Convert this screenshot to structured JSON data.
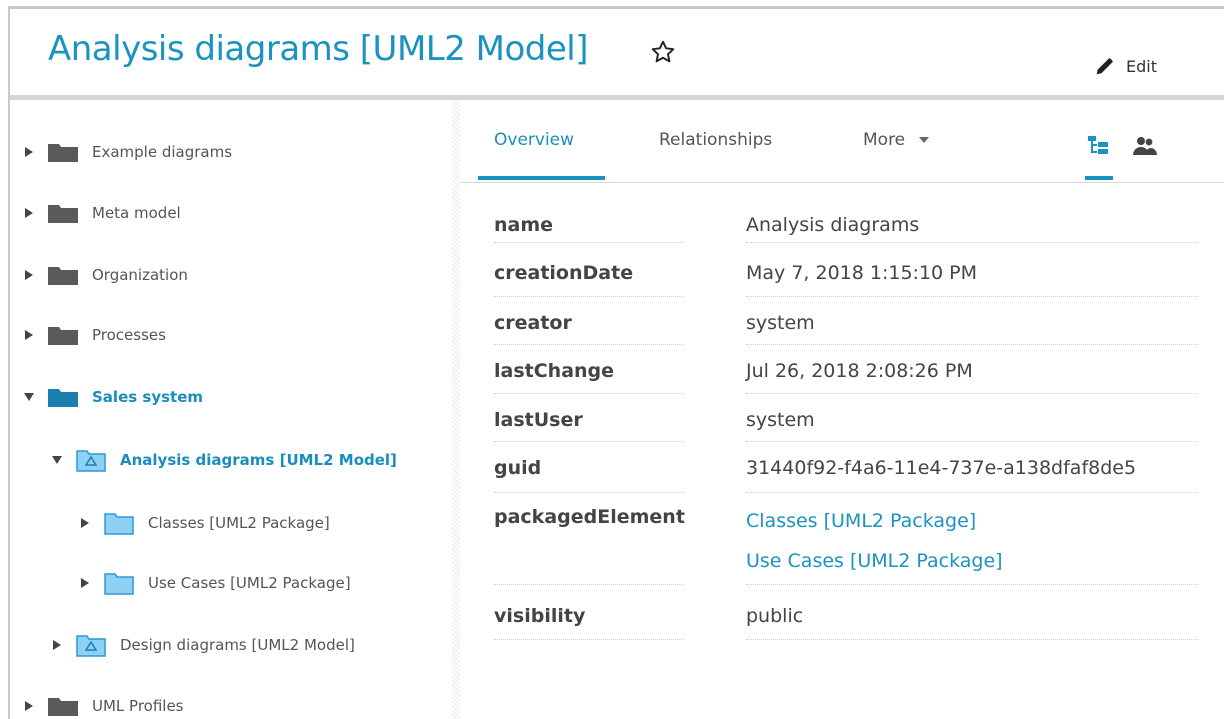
{
  "header": {
    "title": "Analysis diagrams [UML2 Model]",
    "edit_label": "Edit"
  },
  "tree": {
    "items": [
      {
        "label": "Example diagrams",
        "icon": "folder-icon",
        "expanded": false
      },
      {
        "label": "Meta model",
        "icon": "folder-icon",
        "expanded": false
      },
      {
        "label": "Organization",
        "icon": "folder-icon",
        "expanded": false
      },
      {
        "label": "Processes",
        "icon": "folder-icon",
        "expanded": false
      },
      {
        "label": "Sales system",
        "icon": "folder-icon",
        "expanded": true
      },
      {
        "label": "Analysis diagrams [UML2 Model]",
        "icon": "uml-model-icon",
        "expanded": true
      },
      {
        "label": "Classes [UML2 Package]",
        "icon": "uml-package-icon",
        "expanded": false
      },
      {
        "label": "Use Cases [UML2 Package]",
        "icon": "uml-package-icon",
        "expanded": false
      },
      {
        "label": "Design diagrams [UML2 Model]",
        "icon": "uml-model-icon",
        "expanded": false
      },
      {
        "label": "UML Profiles",
        "icon": "folder-icon",
        "expanded": false
      }
    ]
  },
  "tabs": [
    {
      "label": "Overview",
      "active": true
    },
    {
      "label": "Relationships",
      "active": false
    },
    {
      "label": "More",
      "active": false
    }
  ],
  "properties": [
    {
      "name": "name",
      "value": "Analysis diagrams"
    },
    {
      "name": "creationDate",
      "value": "May 7, 2018 1:15:10 PM"
    },
    {
      "name": "creator",
      "value": "system"
    },
    {
      "name": "lastChange",
      "value": "Jul 26, 2018 2:08:26 PM"
    },
    {
      "name": "lastUser",
      "value": "system"
    },
    {
      "name": "guid",
      "value": "31440f92-f4a6-11e4-737e-a138dfaf8de5"
    },
    {
      "name": "packagedElement",
      "links": [
        "Classes [UML2 Package]",
        "Use Cases [UML2 Package]"
      ]
    },
    {
      "name": "visibility",
      "value": "public"
    }
  ],
  "colors": {
    "accent": "#1a93c0",
    "folder_gray": "#5a5a5a",
    "folder_selected": "#1a7fb0",
    "package_blue": "#7cc4f0"
  }
}
